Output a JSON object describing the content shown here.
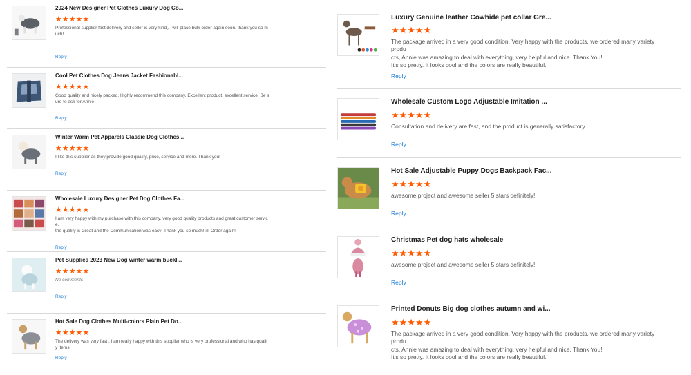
{
  "stars": "★★★★★",
  "reply_label": "Reply",
  "colors": {
    "star": "#ff5a00",
    "link": "#1a7ad4",
    "divider": "#d9d9d9"
  },
  "left_reviews": [
    {
      "title": "2024 New Designer Pet Clothes Luxury Dog Co...",
      "comment_lines": [
        "Professional supplier fast delivery and seller is very kind。 will place bulk order again soon. thank you so m",
        "uch!"
      ],
      "no_comments": false
    },
    {
      "title": "Cool Pet Clothes Dog Jeans Jacket Fashionabl...",
      "comment_lines": [
        "Good quality and nicely packed. Highly recommend this company. Excellent product, excellent service. Be s",
        "ure to ask for Annie"
      ],
      "no_comments": false
    },
    {
      "title": "Winter Warm Pet Apparels Classic Dog Clothes...",
      "comment_lines": [
        "I like this supplier as they provide good quality, price, service and more. Thank you!"
      ],
      "no_comments": false
    },
    {
      "title": "Wholesale Luxury Designer Pet Dog Clothes Fa...",
      "comment_lines": [
        "I am very happy with my purchase with this company. very good quality products and great customer servic",
        "e.",
        "the quality is Great and the Communication was easy! Thank you so much! i'll Order again!"
      ],
      "no_comments": false
    },
    {
      "title": "Pet Supplies 2023 New Dog winter warm buckl...",
      "comment_lines": [
        "No comments"
      ],
      "no_comments": true
    },
    {
      "title": "Hot Sale Dog Clothes Multi-colors Plain Pet Do...",
      "comment_lines": [
        "The delivery was very fast . I am really happy with this supplier who is very professional and who has qualit",
        "y items."
      ],
      "no_comments": false
    }
  ],
  "right_reviews": [
    {
      "title": "Luxury Genuine leather Cowhide pet collar Gre...",
      "comment_lines": [
        "The package arrived in a very good condition. Very happy with the products. we ordered many variety produ",
        "cts, Annie was amazing to deal with everything, very helpful and nice. Thank You!",
        "It's so pretty. It looks cool and the colors are really beautiful."
      ]
    },
    {
      "title": "Wholesale Custom Logo Adjustable Imitation ...",
      "comment_lines": [
        "Consultation and delivery are fast, and the product is generally satisfactory."
      ]
    },
    {
      "title": "Hot Sale Adjustable Puppy Dogs Backpack Fac...",
      "comment_lines": [
        "awesome project and awesome seller 5 stars definitely!"
      ]
    },
    {
      "title": "Christmas Pet dog hats wholesale",
      "comment_lines": [
        "awesome project and awesome seller 5 stars definitely!"
      ]
    },
    {
      "title": "Printed Donuts Big dog clothes autumn and wi...",
      "comment_lines": [
        "The package arrived in a very good condition. Very happy with the products. we ordered many variety produ",
        "cts, Annie was amazing to deal with everything, very helpful and nice. Thank You!",
        "It's so pretty. It looks cool and the colors are really beautiful."
      ]
    }
  ],
  "thumb_icons": {
    "left": [
      "dog-gray-coat-image",
      "denim-jacket-image",
      "dog-winter-apparel-image",
      "dog-clothes-assortment-image",
      "white-dog-winter-coat-image",
      "dog-gray-clothes-image"
    ],
    "right": [
      "greyhound-leather-collar-image",
      "colorful-collars-image",
      "dog-yellow-backpack-image",
      "pet-christmas-hat-image",
      "dog-donut-print-clothes-image"
    ]
  }
}
